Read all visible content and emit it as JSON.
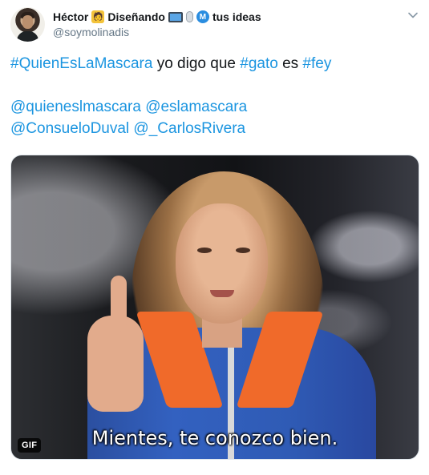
{
  "author": {
    "display_name": "Héctor",
    "bio_word": "Diseñando",
    "emoji_designer": "🧑",
    "emoji_metro": "M",
    "bio_tail": "tus ideas",
    "handle": "@soymolinadis"
  },
  "tweet": {
    "line1": [
      {
        "text": "#QuienEsLaMascara",
        "link": true
      },
      {
        "text": " yo digo que ",
        "link": false
      },
      {
        "text": "#gato",
        "link": true
      },
      {
        "text": " es ",
        "link": false
      },
      {
        "text": "#fey",
        "link": true
      }
    ],
    "line2": [
      {
        "text": "@quieneslmascara",
        "link": true
      },
      {
        "text": " ",
        "link": false
      },
      {
        "text": "@eslamascara",
        "link": true
      }
    ],
    "line3": [
      {
        "text": "@ConsueloDuval",
        "link": true
      },
      {
        "text": " ",
        "link": false
      },
      {
        "text": "@_CarlosRivera",
        "link": true
      }
    ]
  },
  "media": {
    "caption": "Mientes, te conozco bien.",
    "badge": "GIF"
  },
  "icons": {
    "menu": "chevron-down-icon"
  },
  "colors": {
    "link": "#1b95e0",
    "text": "#14171a",
    "muted": "#657786"
  }
}
